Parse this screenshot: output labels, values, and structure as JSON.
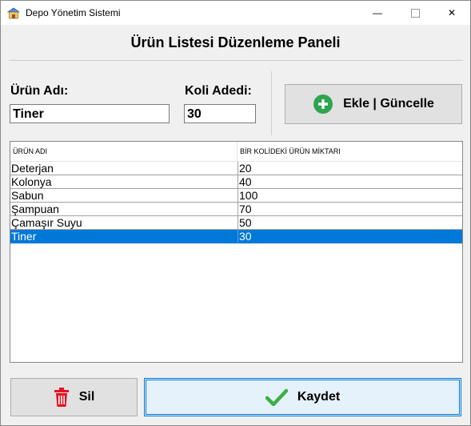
{
  "window": {
    "title": "Depo Yönetim Sistemi",
    "minimize_glyph": "—",
    "close_glyph": "✕"
  },
  "panel_title": "Ürün Listesi Düzenleme Paneli",
  "form": {
    "name_label": "Ürün Adı:",
    "name_value": "Tiner",
    "count_label": "Koli Adedi:",
    "count_value": "30"
  },
  "buttons": {
    "add_update": "Ekle | Güncelle",
    "delete": "Sil",
    "save": "Kaydet"
  },
  "table": {
    "columns": [
      "ÜRÜN ADI",
      "BİR KOLİDEKİ ÜRÜN MİKTARI"
    ],
    "rows": [
      {
        "name": "Deterjan",
        "qty": "20"
      },
      {
        "name": "Kolonya",
        "qty": "40"
      },
      {
        "name": "Sabun",
        "qty": "100"
      },
      {
        "name": "Şampuan",
        "qty": "70"
      },
      {
        "name": "Çamaşır Suyu",
        "qty": "50"
      },
      {
        "name": "Tiner",
        "qty": "30"
      }
    ],
    "selected_index": 5
  },
  "colors": {
    "selection": "#0078d7",
    "add_icon": "#2ea44f",
    "delete_icon": "#e81123",
    "save_icon": "#3cb043"
  },
  "icons": {
    "app": "warehouse-icon",
    "add": "plus-circle-icon",
    "delete": "trash-icon",
    "save": "checkmark-icon"
  }
}
